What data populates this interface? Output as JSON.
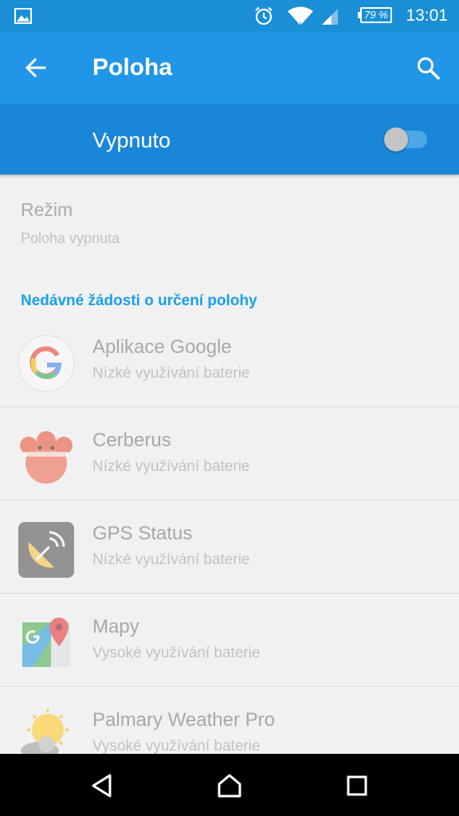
{
  "status_bar": {
    "time": "13:01",
    "battery": "79 %",
    "icons": [
      "image-icon",
      "alarm-icon",
      "wifi-icon",
      "signal-icon",
      "battery-icon"
    ]
  },
  "toolbar": {
    "title": "Poloha",
    "back_icon": "arrow-left-icon",
    "search_icon": "search-icon"
  },
  "location_switch": {
    "label": "Vypnuto",
    "state": "off"
  },
  "mode": {
    "title": "Režim",
    "subtitle": "Poloha vypnuta"
  },
  "recent_requests": {
    "header": "Nedávné žádosti o určení polohy",
    "apps": [
      {
        "name": "Aplikace Google",
        "usage": "Nízké využívání baterie",
        "icon": "google-icon"
      },
      {
        "name": "Cerberus",
        "usage": "Nízké využívání baterie",
        "icon": "cerberus-icon"
      },
      {
        "name": "GPS Status",
        "usage": "Nízké využívání baterie",
        "icon": "gps-status-icon"
      },
      {
        "name": "Mapy",
        "usage": "Vysoké využívání baterie",
        "icon": "maps-icon"
      },
      {
        "name": "Palmary Weather Pro",
        "usage": "Vysoké využívání baterie",
        "icon": "weather-icon"
      }
    ]
  },
  "colors": {
    "status_bar": "#1a8fd6",
    "toolbar": "#2196e8",
    "switch_bar": "#1a86d8",
    "accent": "#1aa0ea"
  },
  "nav_bar": {
    "icons": [
      "back-icon",
      "home-icon",
      "recents-icon"
    ]
  }
}
